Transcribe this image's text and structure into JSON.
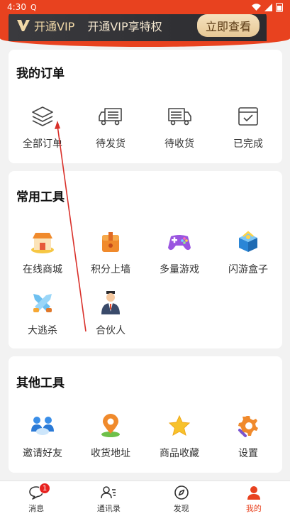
{
  "status_bar": {
    "time": "4:30",
    "notification_glyph": "Q"
  },
  "vip": {
    "title": "开通VIP",
    "subtitle": "开通VIP享特权",
    "button_label": "立即查看",
    "colors": {
      "banner": "#2b2b2f",
      "gold": "#e6c895"
    }
  },
  "orders": {
    "title": "我的订单",
    "items": [
      {
        "label": "全部订单",
        "icon": "layers-icon"
      },
      {
        "label": "待发货",
        "icon": "truck-icon"
      },
      {
        "label": "待收货",
        "icon": "truck-icon"
      },
      {
        "label": "已完成",
        "icon": "check-box-icon"
      }
    ]
  },
  "tools": {
    "title": "常用工具",
    "items": [
      {
        "label": "在线商城",
        "icon": "shop-icon"
      },
      {
        "label": "积分上墙",
        "icon": "box-icon"
      },
      {
        "label": "多量游戏",
        "icon": "gamepad-icon"
      },
      {
        "label": "闪游盒子",
        "icon": "gift-box-icon"
      },
      {
        "label": "大逃杀",
        "icon": "crossed-swords-icon"
      },
      {
        "label": "合伙人",
        "icon": "partner-icon"
      }
    ]
  },
  "other_tools": {
    "title": "其他工具",
    "items": [
      {
        "label": "邀请好友",
        "icon": "invite-icon"
      },
      {
        "label": "收货地址",
        "icon": "location-icon"
      },
      {
        "label": "商品收藏",
        "icon": "star-icon"
      },
      {
        "label": "设置",
        "icon": "gear-icon"
      }
    ]
  },
  "nav": {
    "items": [
      {
        "label": "消息",
        "icon": "message-icon",
        "badge": "1"
      },
      {
        "label": "通讯录",
        "icon": "contacts-icon"
      },
      {
        "label": "发现",
        "icon": "compass-icon"
      },
      {
        "label": "我的",
        "icon": "profile-icon"
      }
    ],
    "active_color": "#e8421f"
  }
}
